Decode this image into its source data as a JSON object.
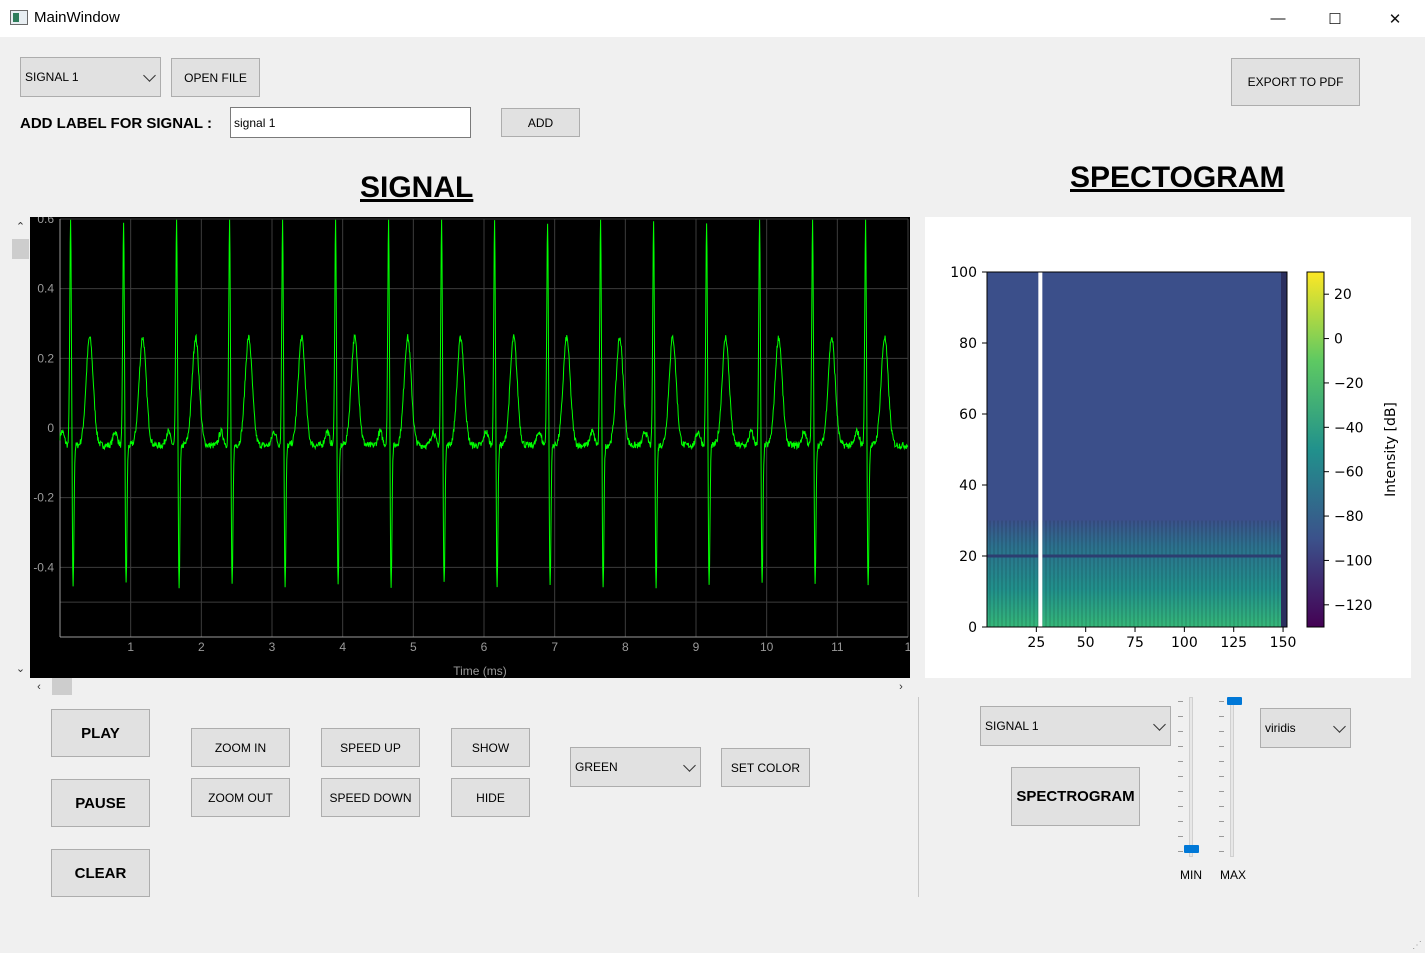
{
  "window": {
    "title": "MainWindow",
    "minimize": "—",
    "maximize": "☐",
    "close": "✕"
  },
  "toolbar": {
    "signal_select": "SIGNAL 1",
    "open_file": "OPEN FILE",
    "export_pdf": "EXPORT TO PDF",
    "label_prompt": "ADD LABEL FOR SIGNAL :",
    "label_value": "signal 1",
    "add": "ADD"
  },
  "signal_panel": {
    "heading": "SIGNAL"
  },
  "spectrogram_panel": {
    "heading": "SPECTOGRAM"
  },
  "controls": {
    "play": "PLAY",
    "pause": "PAUSE",
    "clear": "CLEAR",
    "zoom_in": "ZOOM IN",
    "zoom_out": "ZOOM OUT",
    "speed_up": "SPEED UP",
    "speed_down": "SPEED DOWN",
    "show": "SHOW",
    "hide": "HIDE",
    "color_select": "GREEN",
    "set_color": "SET COLOR"
  },
  "spectro_controls": {
    "signal_select": "SIGNAL 1",
    "colormap_select": "viridis",
    "spectrogram": "SPECTROGRAM",
    "min_label": "MIN",
    "max_label": "MAX",
    "min_value": 0,
    "max_value": 1
  },
  "colors": {
    "trace": "#00ff00",
    "plot_bg": "#000000",
    "grid": "#3c3c3c",
    "slider": "#0078d7"
  },
  "chart_data": [
    {
      "type": "line",
      "title": "",
      "xlabel": "Time (ms)",
      "ylabel": "",
      "xlim": [
        0,
        12
      ],
      "ylim": [
        -0.6,
        0.6
      ],
      "xticks": [
        "1",
        "2",
        "3",
        "4",
        "5",
        "6",
        "7",
        "8",
        "9",
        "10",
        "11",
        "1"
      ],
      "yticks": [
        "0.6",
        "0.4",
        "0.2",
        "0",
        "-0.2",
        "-0.4"
      ],
      "grid": true,
      "series": [
        {
          "beat_times": [
            0.15,
            0.9,
            1.65,
            2.4,
            3.15,
            3.9,
            4.65,
            5.4,
            6.15,
            6.9,
            7.65,
            8.4,
            9.15,
            9.9,
            10.65,
            11.4
          ],
          "baseline": -0.05,
          "r_peak": 0.6,
          "s_trough": -0.46,
          "t_peak": 0.26
        }
      ]
    },
    {
      "type": "heatmap",
      "title": "",
      "xlabel": "",
      "ylabel": "",
      "xlim": [
        0,
        152
      ],
      "ylim": [
        0,
        100
      ],
      "xticks": [
        "25",
        "50",
        "75",
        "100",
        "125",
        "150"
      ],
      "yticks": [
        "0",
        "20",
        "40",
        "60",
        "80",
        "100"
      ],
      "colorbar": {
        "label": "Intensity [dB]",
        "range": [
          -130,
          30
        ],
        "ticks": [
          "20",
          "0",
          "−20",
          "−40",
          "−60",
          "−80",
          "−100",
          "−120"
        ]
      },
      "colormap": "viridis",
      "gap_at_x": 25,
      "band_top": 30,
      "line_at_y": 20
    }
  ]
}
